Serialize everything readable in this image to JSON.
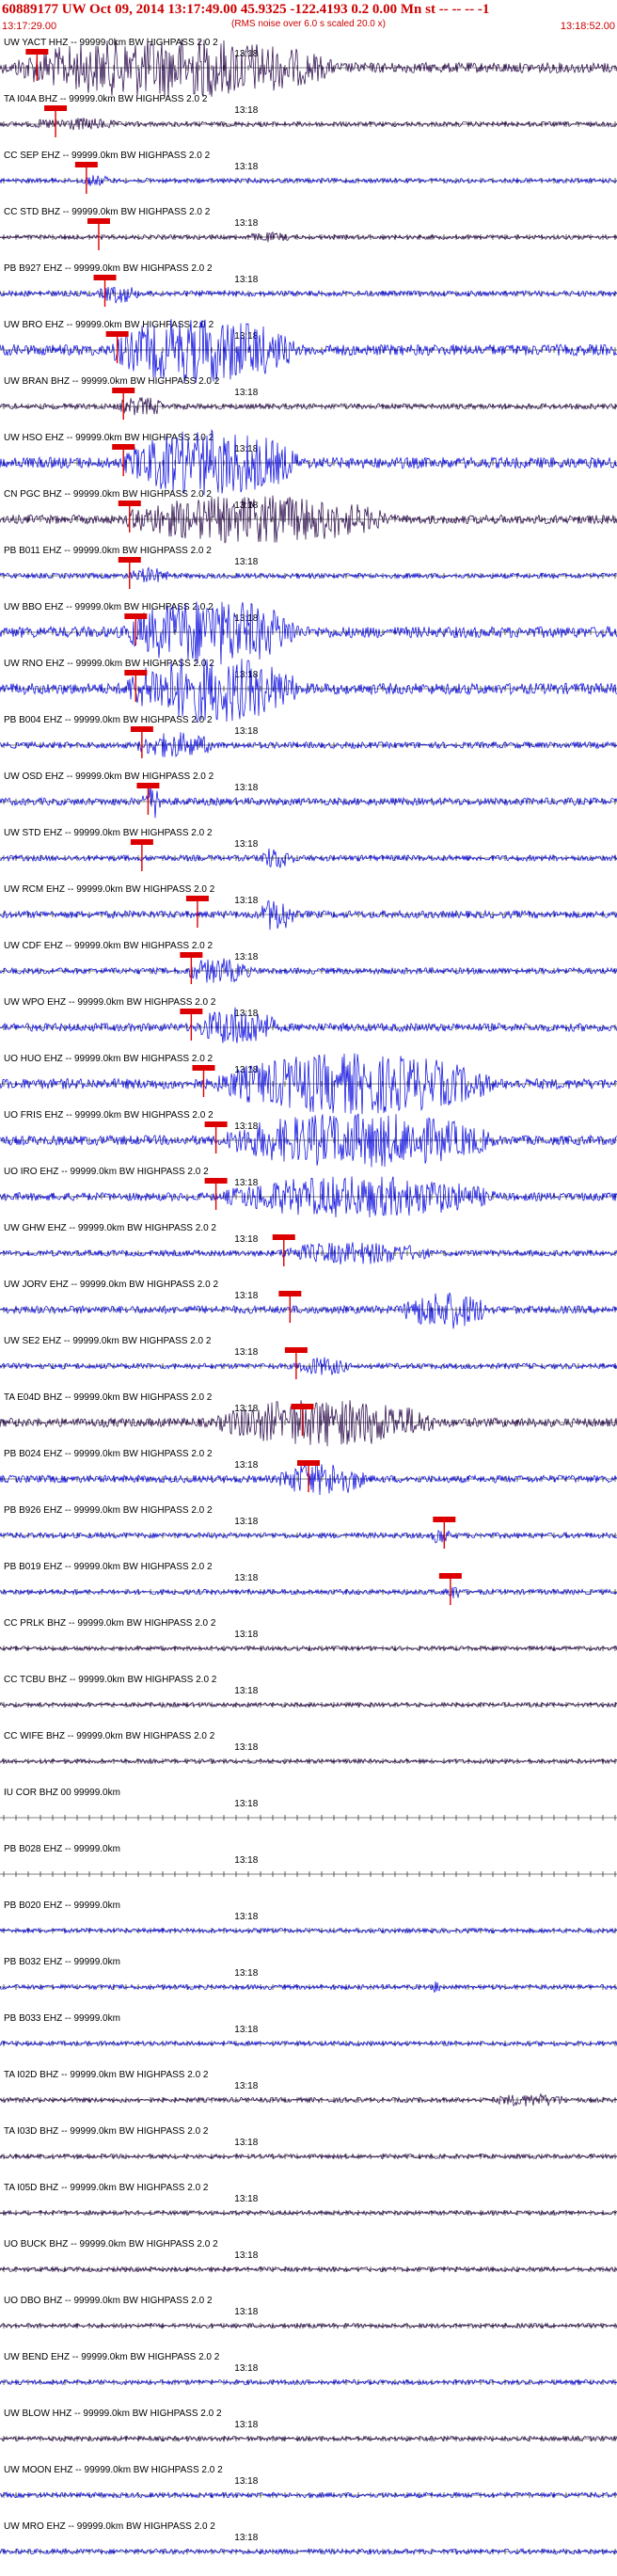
{
  "header": {
    "title": "60889177 UW Oct 09, 2014 13:17:49.00   45.9325 -122.4193  0.2 0.00 Mn st -- -- --  -1",
    "subtitle": "(RMS noise over 6.0 s scaled 20.0 x)",
    "start_time": "13:17:29.00",
    "end_time": "13:18:52.00"
  },
  "tick_label": "13:18",
  "colors": {
    "trace_blue": "#0000dd",
    "trace_dark": "#220044",
    "pick": "#dd0000",
    "text_red": "#cc0000"
  },
  "channels": [
    {
      "label": "UW YACT HHZ -- 99999.0km BW  HIGHPASS  2.0  2",
      "style": "dark",
      "amp": 0.9,
      "burst": [
        0.02,
        0.75
      ],
      "pick": 0.06
    },
    {
      "label": "TA I04A BHZ -- 99999.0km BW  HIGHPASS  2.0  2",
      "style": "dark",
      "amp": 0.15,
      "burst": [
        0.05,
        0.25
      ],
      "pick": 0.09
    },
    {
      "label": "CC SEP EHZ -- 99999.0km BW  HIGHPASS  2.0  2",
      "style": "blue",
      "amp": 0.12,
      "burst": [
        0.13,
        0.2
      ],
      "pick": 0.14
    },
    {
      "label": "CC STD BHZ -- 99999.0km BW  HIGHPASS  2.0  2",
      "style": "dark",
      "amp": 0.1,
      "burst": [
        0.4,
        0.5
      ],
      "pick": 0.16
    },
    {
      "label": "PB B927 EHZ -- 99999.0km BW  HIGHPASS  2.0  2",
      "style": "blue",
      "amp": 0.25,
      "burst": [
        0.16,
        0.25
      ],
      "pick": 0.17
    },
    {
      "label": "UW BRO EHZ -- 99999.0km BW  HIGHPASS  2.0  2",
      "style": "blue",
      "amp": 1.0,
      "burst": [
        0.18,
        0.6
      ],
      "pick": 0.19
    },
    {
      "label": "UW BRAN BHZ -- 99999.0km BW  HIGHPASS  2.0  2",
      "style": "dark",
      "amp": 0.25,
      "burst": [
        0.19,
        0.3
      ],
      "pick": 0.2
    },
    {
      "label": "UW HSO EHZ -- 99999.0km BW  HIGHPASS  2.0  2",
      "style": "blue",
      "amp": 1.0,
      "burst": [
        0.2,
        0.6
      ],
      "pick": 0.2
    },
    {
      "label": "CN PGC BHZ -- 99999.0km BW  HIGHPASS  2.0  2",
      "style": "dark",
      "amp": 0.7,
      "burst": [
        0.2,
        0.8
      ],
      "pick": 0.21
    },
    {
      "label": "PB B011 EHZ -- 99999.0km BW  HIGHPASS  2.0  2",
      "style": "blue",
      "amp": 0.2,
      "burst": [
        0.21,
        0.3
      ],
      "pick": 0.21
    },
    {
      "label": "UW BBO EHZ -- 99999.0km BW  HIGHPASS  2.0  2",
      "style": "blue",
      "amp": 1.0,
      "burst": [
        0.2,
        0.6
      ],
      "pick": 0.22
    },
    {
      "label": "UW RNO EHZ -- 99999.0km BW  HIGHPASS  2.0  2",
      "style": "blue",
      "amp": 1.0,
      "burst": [
        0.2,
        0.6
      ],
      "pick": 0.22
    },
    {
      "label": "PB B004 EHZ -- 99999.0km BW  HIGHPASS  2.0  2",
      "style": "blue",
      "amp": 0.35,
      "burst": [
        0.22,
        0.4
      ],
      "pick": 0.23
    },
    {
      "label": "UW OSD EHZ -- 99999.0km BW  HIGHPASS  2.0  2",
      "style": "blue",
      "amp": 0.5,
      "burst": [
        0.23,
        0.28
      ],
      "pick": 0.24
    },
    {
      "label": "UW STD EHZ -- 99999.0km BW  HIGHPASS  2.0  2",
      "style": "blue",
      "amp": 0.3,
      "burst": [
        0.42,
        0.5
      ],
      "pick": 0.23
    },
    {
      "label": "UW RCM EHZ -- 99999.0km BW  HIGHPASS  2.0  2",
      "style": "blue",
      "amp": 0.5,
      "burst": [
        0.42,
        0.5
      ],
      "pick": 0.32
    },
    {
      "label": "UW CDF EHZ -- 99999.0km BW  HIGHPASS  2.0  2",
      "style": "blue",
      "amp": 0.35,
      "burst": [
        0.3,
        0.45
      ],
      "pick": 0.31
    },
    {
      "label": "UW WPO EHZ -- 99999.0km BW  HIGHPASS  2.0  2",
      "style": "blue",
      "amp": 0.6,
      "burst": [
        0.32,
        0.5
      ],
      "pick": 0.31
    },
    {
      "label": "UO HUO EHZ -- 99999.0km BW  HIGHPASS  2.0  2",
      "style": "blue",
      "amp": 0.9,
      "burst": [
        0.35,
        0.98
      ],
      "pick": 0.33
    },
    {
      "label": "UO FRIS EHZ -- 99999.0km BW  HIGHPASS  2.0  2",
      "style": "blue",
      "amp": 0.8,
      "burst": [
        0.36,
        0.98
      ],
      "pick": 0.35
    },
    {
      "label": "UO IRO EHZ -- 99999.0km BW  HIGHPASS  2.0  2",
      "style": "blue",
      "amp": 0.6,
      "burst": [
        0.36,
        0.98
      ],
      "pick": 0.35
    },
    {
      "label": "UW GHW EHZ -- 99999.0km BW  HIGHPASS  2.0  2",
      "style": "blue",
      "amp": 0.3,
      "burst": [
        0.45,
        0.8
      ],
      "pick": 0.46
    },
    {
      "label": "UW JORV EHZ -- 99999.0km BW  HIGHPASS  2.0  2",
      "style": "blue",
      "amp": 0.55,
      "burst": [
        0.65,
        0.85
      ],
      "pick": 0.47
    },
    {
      "label": "UW SE2 EHZ -- 99999.0km BW  HIGHPASS  2.0  2",
      "style": "blue",
      "amp": 0.25,
      "burst": [
        0.48,
        0.6
      ],
      "pick": 0.48
    },
    {
      "label": "TA E04D BHZ -- 99999.0km BW  HIGHPASS  2.0  2",
      "style": "dark",
      "amp": 0.7,
      "burst": [
        0.35,
        0.85
      ],
      "pick": 0.49
    },
    {
      "label": "PB B024 EHZ -- 99999.0km BW  HIGHPASS  2.0  2",
      "style": "blue",
      "amp": 0.5,
      "burst": [
        0.45,
        0.65
      ],
      "pick": 0.5
    },
    {
      "label": "PB B926 EHZ -- 99999.0km BW  HIGHPASS  2.0  2",
      "style": "blue",
      "amp": 0.25,
      "burst": [
        0.7,
        0.74
      ],
      "pick": 0.72
    },
    {
      "label": "PB B019 EHZ -- 99999.0km BW  HIGHPASS  2.0  2",
      "style": "blue",
      "amp": 0.2,
      "burst": [
        0.72,
        0.76
      ],
      "pick": 0.73
    },
    {
      "label": "CC PRLK BHZ -- 99999.0km BW  HIGHPASS  2.0  2",
      "style": "dark",
      "amp": 0.08,
      "burst": [
        0,
        0
      ],
      "pick": -1
    },
    {
      "label": "CC TCBU BHZ -- 99999.0km BW  HIGHPASS  2.0  2",
      "style": "dark",
      "amp": 0.08,
      "burst": [
        0,
        0
      ],
      "pick": -1
    },
    {
      "label": "CC WIFE BHZ -- 99999.0km BW  HIGHPASS  2.0  2",
      "style": "dark",
      "amp": 0.08,
      "burst": [
        0,
        0
      ],
      "pick": -1
    },
    {
      "label": "IU COR BHZ 00 99999.0km",
      "style": "flat",
      "amp": 0,
      "burst": [
        0,
        0
      ],
      "pick": -1
    },
    {
      "label": "PB B028 EHZ -- 99999.0km",
      "style": "flat",
      "amp": 0,
      "burst": [
        0,
        0
      ],
      "pick": -1
    },
    {
      "label": "PB B020 EHZ -- 99999.0km",
      "style": "blue",
      "amp": 0.12,
      "burst": [
        0,
        0
      ],
      "pick": -1
    },
    {
      "label": "PB B032 EHZ -- 99999.0km",
      "style": "blue",
      "amp": 0.15,
      "burst": [
        0.7,
        0.72
      ],
      "pick": -1
    },
    {
      "label": "PB B033 EHZ -- 99999.0km",
      "style": "blue",
      "amp": 0.12,
      "burst": [
        0,
        0
      ],
      "pick": -1
    },
    {
      "label": "TA I02D BHZ -- 99999.0km BW  HIGHPASS  2.0  2",
      "style": "dark",
      "amp": 0.15,
      "burst": [
        0.8,
        0.97
      ],
      "pick": -1
    },
    {
      "label": "TA I03D BHZ -- 99999.0km BW  HIGHPASS  2.0  2",
      "style": "dark",
      "amp": 0.1,
      "burst": [
        0,
        0
      ],
      "pick": -1
    },
    {
      "label": "TA I05D BHZ -- 99999.0km BW  HIGHPASS  2.0  2",
      "style": "dark",
      "amp": 0.08,
      "burst": [
        0,
        0
      ],
      "pick": -1
    },
    {
      "label": "UO BUCK BHZ -- 99999.0km BW  HIGHPASS  2.0  2",
      "style": "dark",
      "amp": 0.12,
      "burst": [
        0,
        0
      ],
      "pick": -1
    },
    {
      "label": "UO DBO BHZ -- 99999.0km BW  HIGHPASS  2.0  2",
      "style": "dark",
      "amp": 0.12,
      "burst": [
        0,
        0
      ],
      "pick": -1
    },
    {
      "label": "UW BEND EHZ -- 99999.0km BW  HIGHPASS  2.0  2",
      "style": "blue",
      "amp": 0.15,
      "burst": [
        0,
        0
      ],
      "pick": -1
    },
    {
      "label": "UW BLOW HHZ -- 99999.0km BW  HIGHPASS  2.0  2",
      "style": "dark",
      "amp": 0.15,
      "burst": [
        0,
        0
      ],
      "pick": -1
    },
    {
      "label": "UW MOON EHZ -- 99999.0km BW  HIGHPASS  2.0  2",
      "style": "blue",
      "amp": 0.2,
      "burst": [
        0,
        0
      ],
      "pick": -1
    },
    {
      "label": "UW MRO EHZ -- 99999.0km BW  HIGHPASS  2.0  2",
      "style": "blue",
      "amp": 0.2,
      "burst": [
        0,
        0
      ],
      "pick": -1
    }
  ]
}
